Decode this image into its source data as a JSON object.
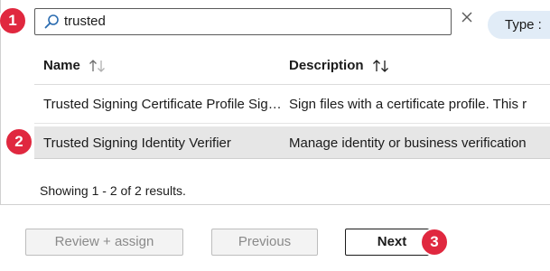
{
  "search": {
    "value": "trusted",
    "clear_icon": "close-icon",
    "search_icon": "search-icon"
  },
  "filter": {
    "type_label": "Type :"
  },
  "badges": {
    "step1": "1",
    "step2": "2",
    "step3": "3",
    "color": "#e0283f"
  },
  "table": {
    "columns": [
      "Name",
      "Description"
    ],
    "rows": [
      {
        "name": "Trusted Signing Certificate Profile Signer",
        "description": "Sign files with a certificate profile. This r"
      },
      {
        "name": "Trusted Signing Identity Verifier",
        "description": "Manage identity or business verification"
      }
    ],
    "selected_row_index": 1
  },
  "results_text": "Showing 1 - 2 of 2 results.",
  "footer": {
    "review_label": "Review + assign",
    "previous_label": "Previous",
    "next_label": "Next"
  }
}
